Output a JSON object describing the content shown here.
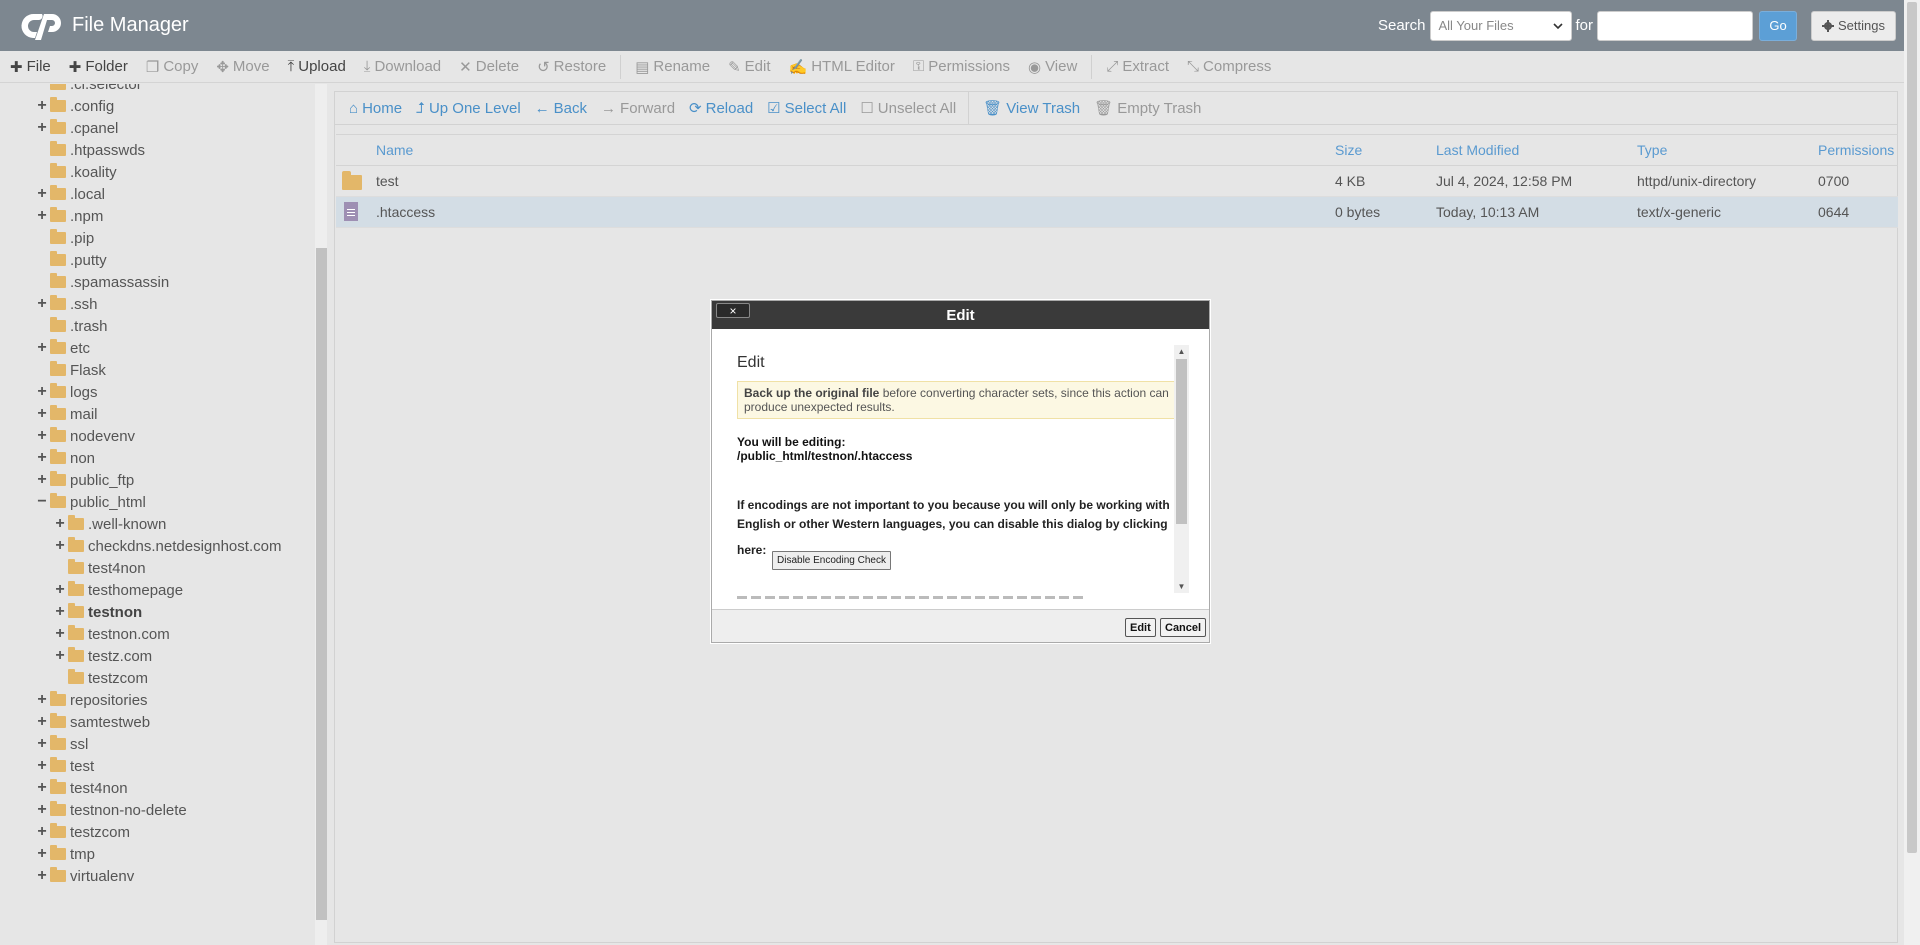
{
  "header": {
    "app_title": "File Manager",
    "search_label": "Search",
    "search_scope": "All Your Files",
    "for_label": "for",
    "search_value": "",
    "go_label": "Go",
    "settings_label": "Settings"
  },
  "toolbar": {
    "file": "File",
    "folder": "Folder",
    "copy": "Copy",
    "move": "Move",
    "upload": "Upload",
    "download": "Download",
    "delete": "Delete",
    "restore": "Restore",
    "rename": "Rename",
    "edit": "Edit",
    "html_editor": "HTML Editor",
    "permissions": "Permissions",
    "view": "View",
    "extract": "Extract",
    "compress": "Compress"
  },
  "nav": {
    "home": "Home",
    "up": "Up One Level",
    "back": "Back",
    "forward": "Forward",
    "reload": "Reload",
    "select_all": "Select All",
    "unselect_all": "Unselect All",
    "view_trash": "View Trash",
    "empty_trash": "Empty Trash"
  },
  "tree": [
    {
      "label": ".cl.selector",
      "toggle": "",
      "level": 1
    },
    {
      "label": ".config",
      "toggle": "+",
      "level": 1
    },
    {
      "label": ".cpanel",
      "toggle": "+",
      "level": 1
    },
    {
      "label": ".htpasswds",
      "toggle": "",
      "level": 1
    },
    {
      "label": ".koality",
      "toggle": "",
      "level": 1
    },
    {
      "label": ".local",
      "toggle": "+",
      "level": 1
    },
    {
      "label": ".npm",
      "toggle": "+",
      "level": 1
    },
    {
      "label": ".pip",
      "toggle": "",
      "level": 1
    },
    {
      "label": ".putty",
      "toggle": "",
      "level": 1
    },
    {
      "label": ".spamassassin",
      "toggle": "",
      "level": 1
    },
    {
      "label": ".ssh",
      "toggle": "+",
      "level": 1
    },
    {
      "label": ".trash",
      "toggle": "",
      "level": 1
    },
    {
      "label": "etc",
      "toggle": "+",
      "level": 1
    },
    {
      "label": "Flask",
      "toggle": "",
      "level": 1
    },
    {
      "label": "logs",
      "toggle": "+",
      "level": 1
    },
    {
      "label": "mail",
      "toggle": "+",
      "level": 1
    },
    {
      "label": "nodevenv",
      "toggle": "+",
      "level": 1
    },
    {
      "label": "non",
      "toggle": "+",
      "level": 1
    },
    {
      "label": "public_ftp",
      "toggle": "+",
      "level": 1
    },
    {
      "label": "public_html",
      "toggle": "−",
      "level": 1
    },
    {
      "label": ".well-known",
      "toggle": "+",
      "level": 2
    },
    {
      "label": "checkdns.netdesignhost.com",
      "toggle": "+",
      "level": 2
    },
    {
      "label": "test4non",
      "toggle": "",
      "level": 2
    },
    {
      "label": "testhomepage",
      "toggle": "+",
      "level": 2
    },
    {
      "label": "testnon",
      "toggle": "+",
      "level": 2,
      "bold": true
    },
    {
      "label": "testnon.com",
      "toggle": "+",
      "level": 2
    },
    {
      "label": "testz.com",
      "toggle": "+",
      "level": 2
    },
    {
      "label": "testzcom",
      "toggle": "",
      "level": 2
    },
    {
      "label": "repositories",
      "toggle": "+",
      "level": 1
    },
    {
      "label": "samtestweb",
      "toggle": "+",
      "level": 1
    },
    {
      "label": "ssl",
      "toggle": "+",
      "level": 1
    },
    {
      "label": "test",
      "toggle": "+",
      "level": 1
    },
    {
      "label": "test4non",
      "toggle": "+",
      "level": 1
    },
    {
      "label": "testnon-no-delete",
      "toggle": "+",
      "level": 1
    },
    {
      "label": "testzcom",
      "toggle": "+",
      "level": 1
    },
    {
      "label": "tmp",
      "toggle": "+",
      "level": 1
    },
    {
      "label": "virtualenv",
      "toggle": "+",
      "level": 1
    }
  ],
  "table": {
    "columns": [
      "Name",
      "Size",
      "Last Modified",
      "Type",
      "Permissions"
    ],
    "rows": [
      {
        "name": "test",
        "size": "4 KB",
        "modified": "Jul 4, 2024, 12:58 PM",
        "type": "httpd/unix-directory",
        "perms": "0700",
        "icon": "folder-icon"
      },
      {
        "name": ".htaccess",
        "size": "0 bytes",
        "modified": "Today, 10:13 AM",
        "type": "text/x-generic",
        "perms": "0644",
        "icon": "file-icon",
        "selected": true
      }
    ]
  },
  "modal": {
    "title": "Edit",
    "close": "×",
    "heading": "Edit",
    "warn_bold": "Back up the original file",
    "warn_rest": " before converting character sets, since this action can produce unexpected results.",
    "editing_label": "You will be editing:",
    "path": "/public_html/testnon/.htaccess",
    "para": "If encodings are not important to you because you will only be working with English or other Western languages, you can disable this dialog by clicking",
    "here": "here:",
    "disable_btn": "Disable Encoding Check",
    "edit_btn": "Edit",
    "cancel_btn": "Cancel"
  },
  "colors": {
    "header_bg": "#7d8790",
    "link_blue": "#4a90c8",
    "folder": "#e3b769",
    "modal_head": "#3a3a3a"
  }
}
